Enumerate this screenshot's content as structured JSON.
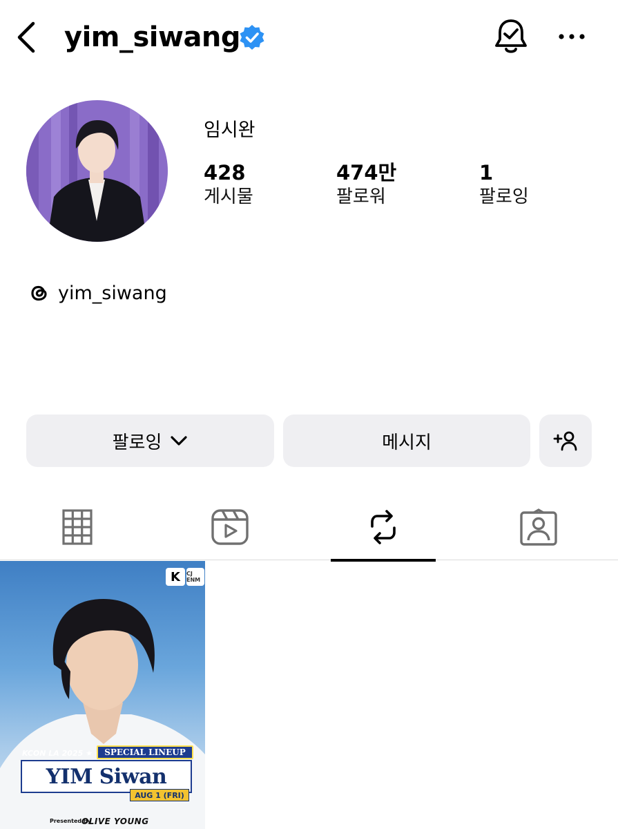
{
  "header": {
    "username": "yim_siwang",
    "back_icon": "chevron-left-icon",
    "verified_icon": "verified-badge-icon",
    "verified_color": "#2d92f4",
    "notification_icon": "bell-check-icon",
    "more_icon": "more-horizontal-icon"
  },
  "profile": {
    "display_name": "임시완",
    "stats": [
      {
        "value": "428",
        "label": "게시물"
      },
      {
        "value": "474만",
        "label": "팔로워"
      },
      {
        "value": "1",
        "label": "팔로잉"
      }
    ],
    "threads_handle": "yim_siwang",
    "threads_icon": "threads-icon"
  },
  "actions": {
    "following_label": "팔로잉",
    "following_icon": "chevron-down-icon",
    "message_label": "메시지",
    "add_user_icon": "add-person-icon",
    "button_bg": "#efeff2"
  },
  "tabs": [
    {
      "icon": "grid-icon",
      "active": false
    },
    {
      "icon": "reels-icon",
      "active": false
    },
    {
      "icon": "repost-icon",
      "active": true
    },
    {
      "icon": "tagged-icon",
      "active": false
    }
  ],
  "post": {
    "event": "KCON LA 2025 ★ ★ ★",
    "lineup": "SPECIAL LINEUP",
    "name": "YIM Siwan",
    "date": "AUG 1 (FRI)",
    "presented_by": "Presented by",
    "sponsor": "OLIVE YOUNG",
    "brand_k": "K",
    "brand_cj": "CJ ENM"
  }
}
